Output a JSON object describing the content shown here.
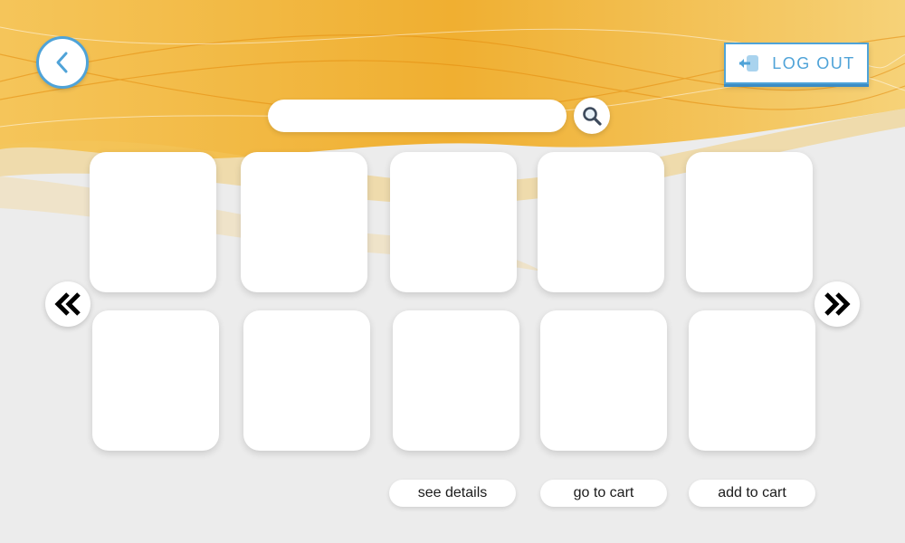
{
  "header": {
    "back_icon": "chevron-left-icon",
    "logout": {
      "label": "LOG OUT",
      "icon": "logout-door-icon"
    }
  },
  "search": {
    "value": "",
    "placeholder": "",
    "icon": "search-icon"
  },
  "grid": {
    "rows": 2,
    "cols": 5,
    "cards": [
      "",
      "",
      "",
      "",
      "",
      "",
      "",
      "",
      "",
      ""
    ]
  },
  "carousel": {
    "prev_icon": "double-chevron-left-icon",
    "next_icon": "double-chevron-right-icon"
  },
  "actions": {
    "see_details": "see details",
    "go_to_cart": "go to cart",
    "add_to_cart": "add to cart"
  },
  "colors": {
    "accent": "#4fa3d8",
    "background": "#ececec",
    "wave": "#f3b521"
  }
}
